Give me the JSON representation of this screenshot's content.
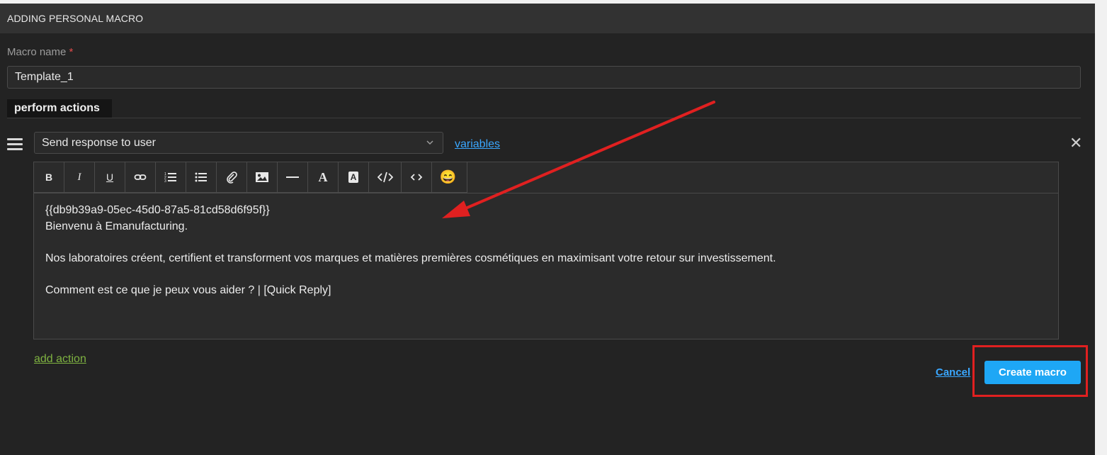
{
  "header": {
    "title": "ADDING PERSONAL MACRO"
  },
  "form": {
    "macro_name_label": "Macro name",
    "required_mark": "*",
    "macro_name_value": "Template_1"
  },
  "tabs": {
    "active": "perform actions"
  },
  "action": {
    "select_value": "Send response to user",
    "variables_link": "variables"
  },
  "toolbar": {
    "buttons": [
      {
        "name": "bold",
        "glyph": "B"
      },
      {
        "name": "italic",
        "glyph": "I"
      },
      {
        "name": "underline",
        "glyph": "U"
      },
      {
        "name": "link",
        "glyph": "link-icon"
      },
      {
        "name": "ordered-list",
        "glyph": "ordered-list-icon"
      },
      {
        "name": "unordered-list",
        "glyph": "unordered-list-icon"
      },
      {
        "name": "attachment",
        "glyph": "paperclip-icon"
      },
      {
        "name": "image",
        "glyph": "image-icon"
      },
      {
        "name": "horizontal-rule",
        "glyph": "hr-icon"
      },
      {
        "name": "font-color",
        "glyph": "A"
      },
      {
        "name": "background-color",
        "glyph": "A"
      },
      {
        "name": "code-block",
        "glyph": "code-block-icon"
      },
      {
        "name": "inline-code",
        "glyph": "inline-code-icon"
      },
      {
        "name": "emoji",
        "glyph": "😄"
      }
    ]
  },
  "editor": {
    "line1": "{{db9b39a9-05ec-45d0-87a5-81cd58d6f95f}}",
    "line2": "Bienvenu à Emanufacturing.",
    "line3": "Nos laboratoires créent, certifient et transforment vos marques et matières premières cosmétiques en maximisant votre retour sur investissement.",
    "line4": "Comment est ce que je peux vous aider ? | [Quick Reply]"
  },
  "footer": {
    "add_action": "add action",
    "cancel": "Cancel",
    "create": "Create macro"
  },
  "colors": {
    "accent": "#1ea7f5",
    "link": "#3aa7ff",
    "add_action": "#7fb341",
    "annotation": "#e02020"
  }
}
